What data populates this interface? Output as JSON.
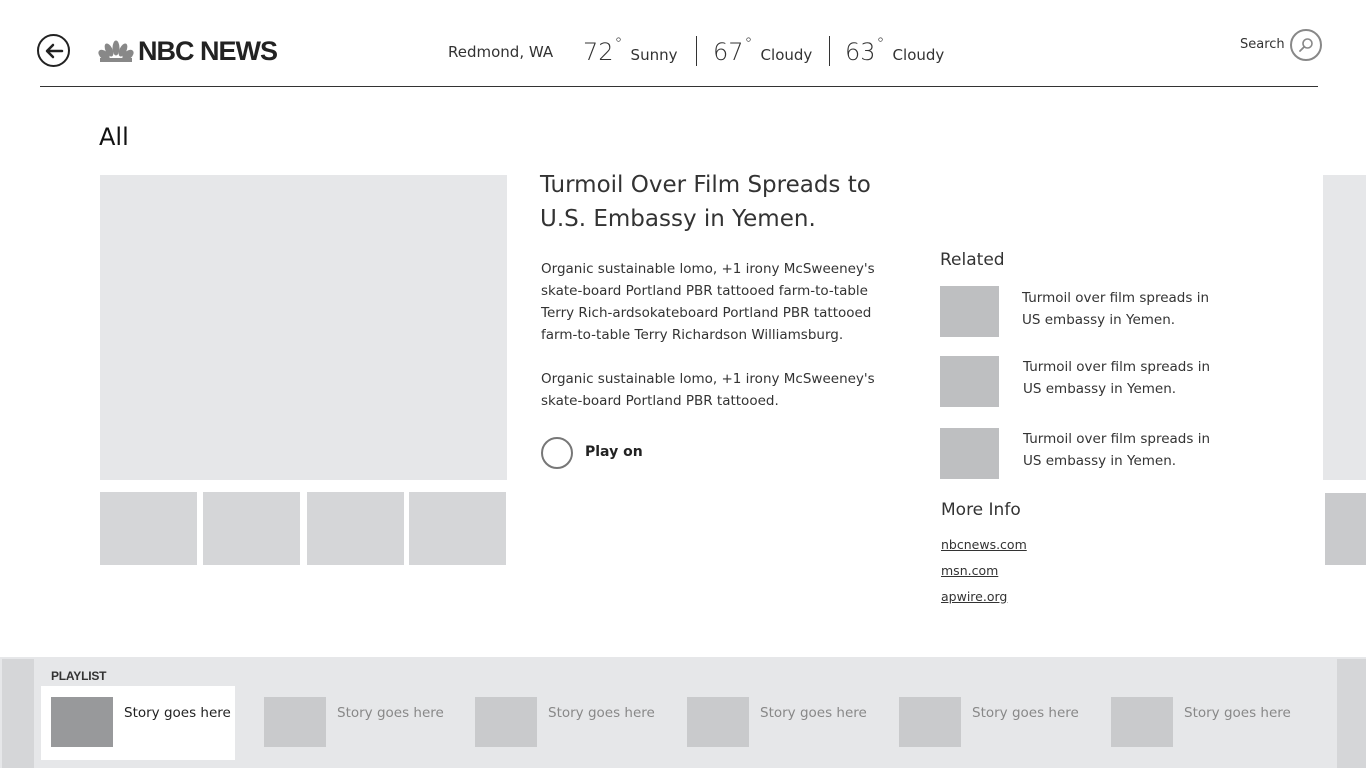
{
  "header": {
    "logo_text": "NBC NEWS",
    "weather": {
      "location": "Redmond, WA",
      "items": [
        {
          "temp": "72",
          "condition": "Sunny"
        },
        {
          "temp": "67",
          "condition": "Cloudy"
        },
        {
          "temp": "63",
          "condition": "Cloudy"
        }
      ],
      "degree_symbol": "°"
    },
    "search_label": "Search"
  },
  "page_title": "All",
  "article": {
    "headline": "Turmoil Over Film Spreads to U.S. Embassy in Yemen.",
    "paragraphs": [
      "Organic sustainable lomo, +1 irony McSweeney's skate-board Portland PBR tattooed farm-to-table Terry Rich-ardsokateboard Portland PBR tattooed farm-to-table Terry Richardson Williamsburg.",
      "Organic sustainable lomo, +1 irony McSweeney's skate-board Portland PBR tattooed."
    ],
    "play_label": "Play on"
  },
  "related": {
    "title": "Related",
    "items": [
      {
        "text": "Turmoil over film spreads in US embassy in Yemen."
      },
      {
        "text": "Turmoil over film spreads in US embassy in Yemen."
      },
      {
        "text": "Turmoil over film spreads in US embassy in Yemen."
      }
    ]
  },
  "more_info": {
    "title": "More Info",
    "links": [
      "nbcnews.com",
      "msn.com",
      "apwire.org"
    ]
  },
  "playlist": {
    "label": "PLAYLIST",
    "items": [
      {
        "text": "Story goes here",
        "active": true
      },
      {
        "text": "Story goes here",
        "active": false
      },
      {
        "text": "Story goes here",
        "active": false
      },
      {
        "text": "Story goes here",
        "active": false
      },
      {
        "text": "Story goes here",
        "active": false
      },
      {
        "text": "Story goes here",
        "active": false
      }
    ]
  }
}
